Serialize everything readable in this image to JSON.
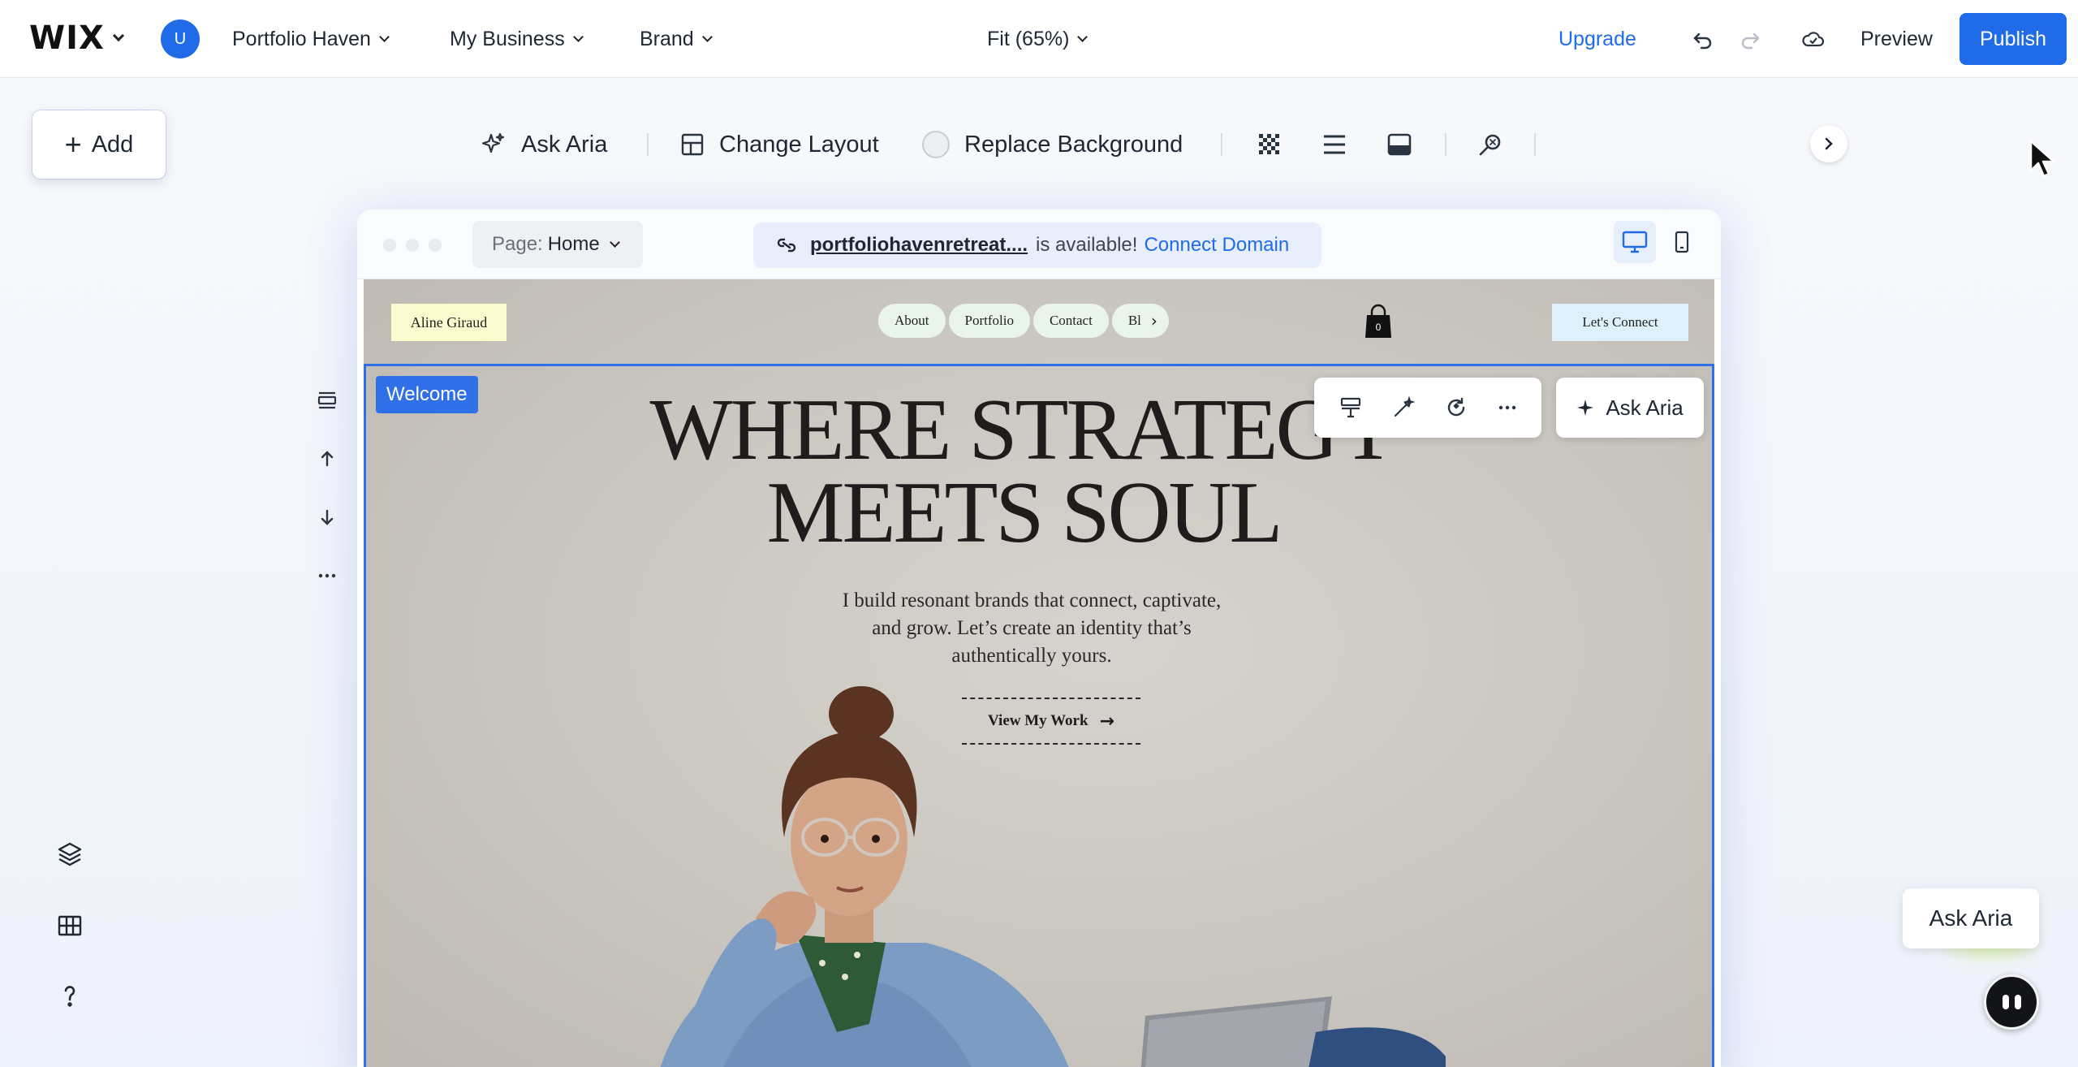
{
  "topbar": {
    "logo": "WIX",
    "avatar_initial": "U",
    "site_menu": "Portfolio Haven",
    "business_menu": "My Business",
    "brand_menu": "Brand",
    "zoom": "Fit (65%)",
    "upgrade": "Upgrade",
    "preview": "Preview",
    "publish": "Publish"
  },
  "add_button": {
    "label": "Add"
  },
  "toolbar": {
    "ask_aria": "Ask Aria",
    "change_layout": "Change Layout",
    "replace_background": "Replace Background"
  },
  "frame": {
    "page_prefix": "Page:",
    "page_name": "Home",
    "domain": "portfoliohavenretreat....",
    "domain_status": "is available!",
    "connect_domain": "Connect Domain"
  },
  "site": {
    "name": "Aline Giraud",
    "nav": [
      "About",
      "Portfolio",
      "Contact",
      "Bl"
    ],
    "cart_count": "0",
    "cta_header": "Let's Connect",
    "section_tag": "Welcome",
    "hero_title_line1": "WHERE STRATEGY",
    "hero_title_line2": "MEETS SOUL",
    "hero_sub": "I build resonant brands that connect, captivate, and grow. Let’s create an identity that’s authentically yours.",
    "hero_cta": "View My Work",
    "section_ask_aria": "Ask Aria"
  },
  "aria_widget": {
    "label": "Ask Aria"
  },
  "colors": {
    "accent": "#1f6be8",
    "selection": "#2f6fe8",
    "canvas": "#c9c5bf"
  }
}
